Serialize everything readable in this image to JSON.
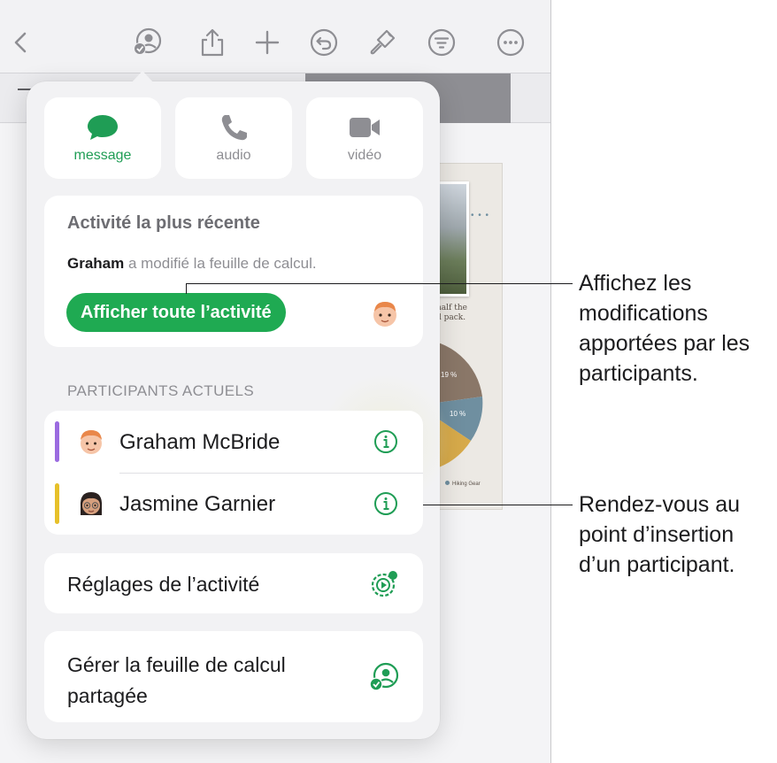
{
  "toolbar": {
    "icons": [
      "back-chevron-icon",
      "collaboration-icon",
      "share-icon",
      "add-icon",
      "undo-icon",
      "format-brush-icon",
      "filter-icon",
      "more-icon"
    ]
  },
  "document": {
    "caption_line1": "half the",
    "caption_line2": "d pack.",
    "pie_label_1": "19 %",
    "pie_label_2": "10 %",
    "legend_entry": "Hiking Gear"
  },
  "popover": {
    "comm_buttons": [
      {
        "label": "message",
        "icon": "message-icon",
        "active": true
      },
      {
        "label": "audio",
        "icon": "phone-icon",
        "active": false
      },
      {
        "label": "vidéo",
        "icon": "video-camera-icon",
        "active": false
      }
    ],
    "activity": {
      "title": "Activité la plus récente",
      "actor": "Graham",
      "action": " a modifié la feuille de calcul.",
      "button": "Afficher toute l’activité"
    },
    "section_label": "PARTICIPANTS ACTUELS",
    "participants": [
      {
        "name": "Graham McBride",
        "color": "#9b6be0"
      },
      {
        "name": "Jasmine Garnier",
        "color": "#e6c02a"
      }
    ],
    "settings_label": "Réglages de l’activité",
    "manage_label": "Gérer la feuille de calcul partagée"
  },
  "callouts": {
    "first": "Affichez les modifications apportées par les participants.",
    "second": "Rendez-vous au point d’insertion d’un participant."
  },
  "colors": {
    "accent": "#1faa52",
    "icon_green": "#1f9d55",
    "toolbar_icon": "#8e8e93"
  }
}
